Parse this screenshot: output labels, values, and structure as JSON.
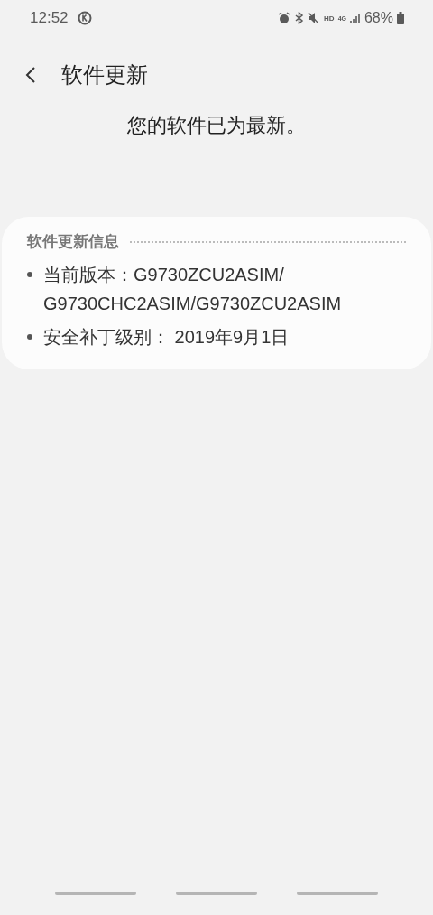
{
  "status_bar": {
    "time": "12:52",
    "network": "4G",
    "hd": "HD",
    "battery": "68%"
  },
  "header": {
    "title": "软件更新"
  },
  "message": "您的软件已为最新。",
  "info_card": {
    "title": "软件更新信息",
    "items": [
      "当前版本：G9730ZCU2ASIM/G9730CHC2ASIM/G9730ZCU2ASIM",
      "安全补丁级别： 2019年9月1日"
    ]
  }
}
